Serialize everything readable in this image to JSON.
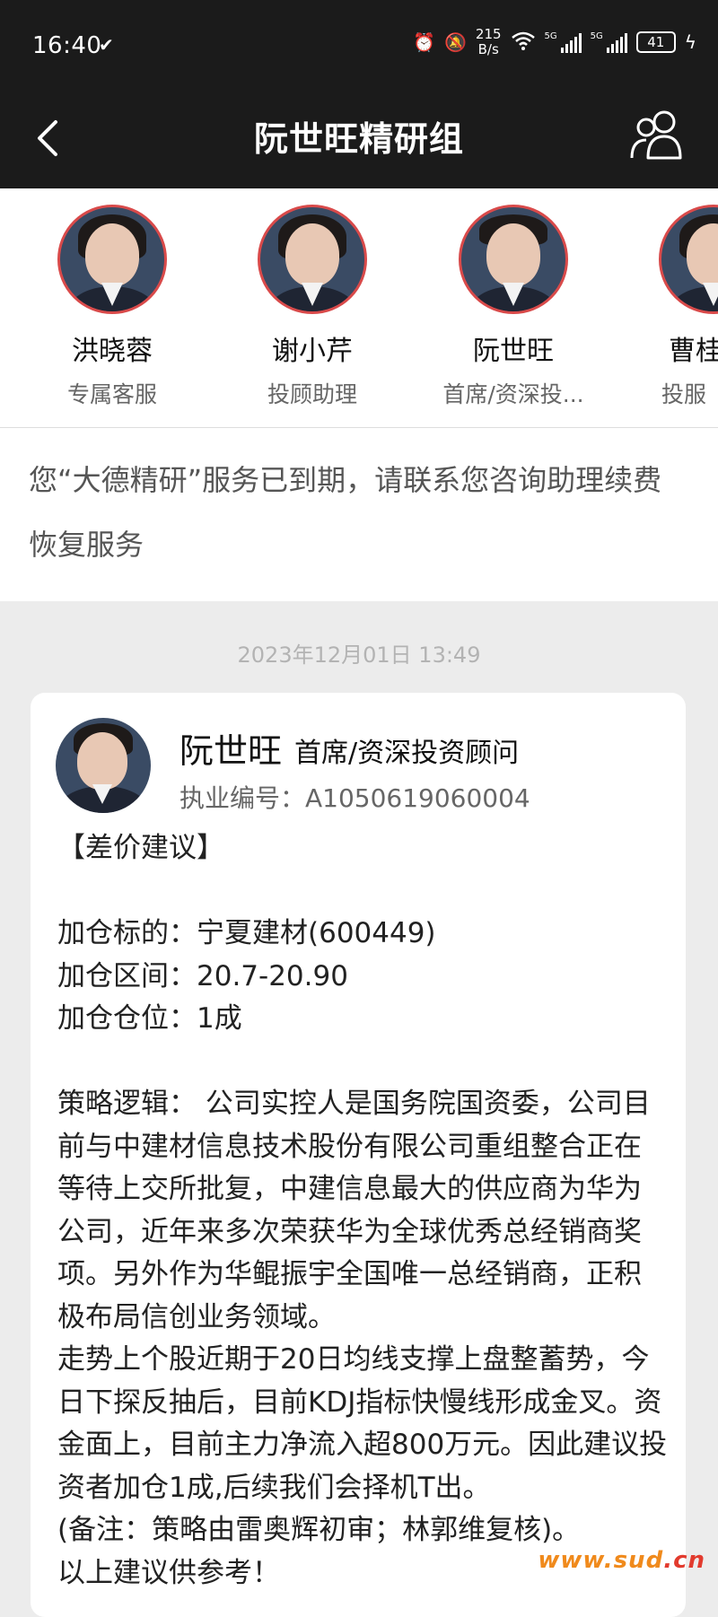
{
  "status_bar": {
    "time": "16:40",
    "net_speed_value": "215",
    "net_speed_unit": "B/s",
    "signal_1_label": "5G",
    "signal_2_label": "5G",
    "battery": "41"
  },
  "nav": {
    "title": "阮世旺精研组"
  },
  "advisors": [
    {
      "name": "洪晓蓉",
      "role": "专属客服"
    },
    {
      "name": "谢小芹",
      "role": "投顾助理"
    },
    {
      "name": "阮世旺",
      "role": "首席/资深投..."
    },
    {
      "name": "曹桂",
      "role": "投服"
    }
  ],
  "notice": "您“大德精研”服务已到期，请联系您咨询助理续费恢复服务",
  "message": {
    "timestamp": "2023年12月01日 13:49",
    "author_name": "阮世旺",
    "author_title": "首席/资深投资顾问",
    "license": "执业编号：A1050619060004",
    "body": "【差价建议】\n\n加仓标的：宁夏建材(600449)\n加仓区间：20.7-20.90\n加仓仓位：1成\n\n策略逻辑： 公司实控人是国务院国资委，公司目前与中建材信息技术股份有限公司重组整合正在等待上交所批复，中建信息最大的供应商为华为公司，近年来多次荣获华为全球优秀总经销商奖项。另外作为华鲲振宇全国唯一总经销商，正积极布局信创业务领域。\n走势上个股近期于20日均线支撑上盘整蓄势，今日下探反抽后，目前KDJ指标快慢线形成金叉。资金面上，目前主力净流入超800万元。因此建议投资者加仓1成,后续我们会择机T出。\n(备注：策略由雷奥辉初审；林郭维复核)。\n以上建议供参考！"
  },
  "watermark": {
    "prefix": "www.sud",
    "suffix": ".cn"
  }
}
